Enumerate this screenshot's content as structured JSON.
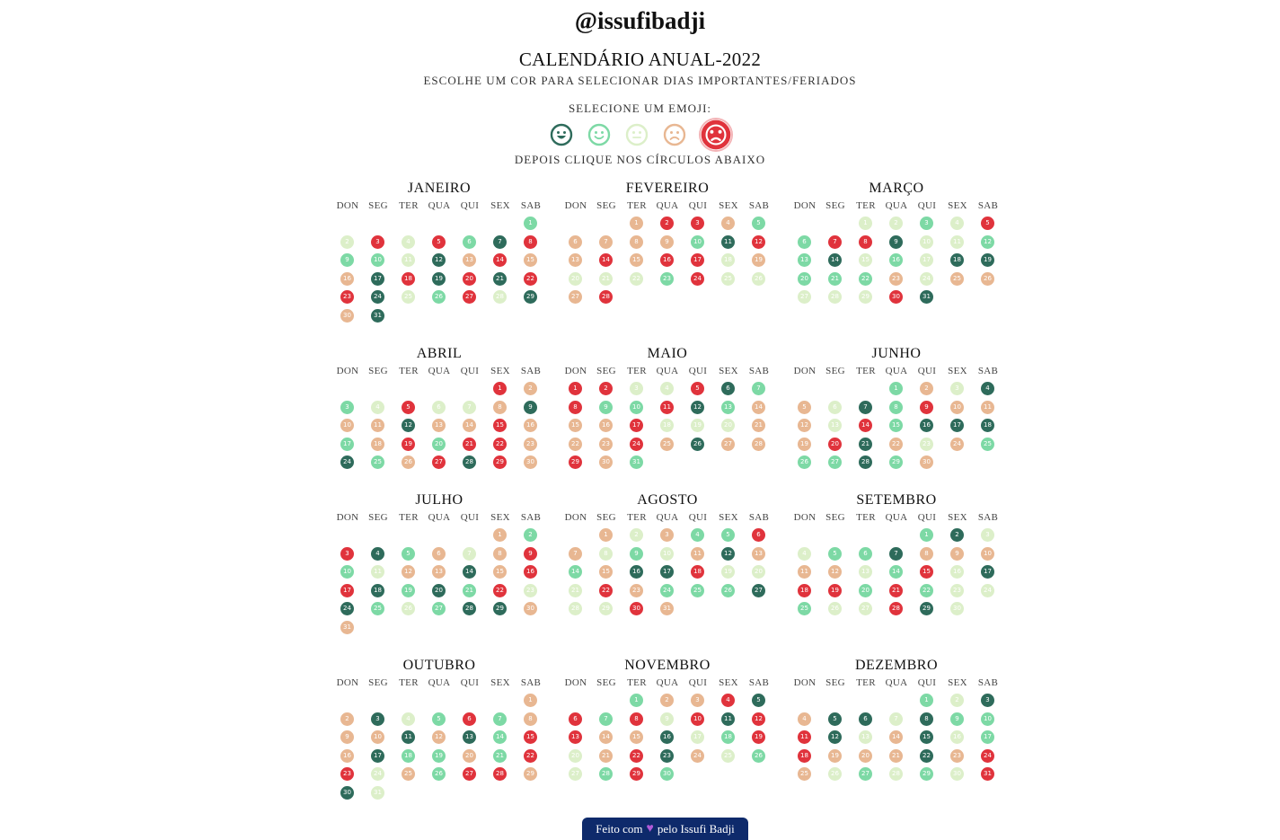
{
  "header": {
    "handle": "@issufibadji",
    "title": "CALENDÁRIO ANUAL-2022",
    "subtitle": "ESCOLHE UM COR PARA SELECIONAR DIAS IMPORTANTES/FERIADOS",
    "emoji_label": "SELECIONE UM EMOJI:",
    "after_label": "DEPOIS CLIQUE NOS CÍRCULOS ABAIXO"
  },
  "palette": {
    "1": "#2e6b5b",
    "2": "#7dd9a5",
    "3": "#dcefc9",
    "4": "#e8b792",
    "5": "#e0333c"
  },
  "emojis": [
    {
      "name": "grinning-face-icon",
      "face": "grin",
      "color": "#2e6b5b",
      "selected": false
    },
    {
      "name": "smiling-face-icon",
      "face": "smile",
      "color": "#7dd9a5",
      "selected": false
    },
    {
      "name": "neutral-face-icon",
      "face": "neutral",
      "color": "#dcefc9",
      "selected": false
    },
    {
      "name": "frowning-face-icon",
      "face": "frown",
      "color": "#e8b792",
      "selected": false
    },
    {
      "name": "angry-face-icon",
      "face": "angry",
      "color": "#e0333c",
      "selected": true
    }
  ],
  "weekday_labels": [
    "DON",
    "SEG",
    "TER",
    "QUA",
    "QUI",
    "SEX",
    "SAB"
  ],
  "months": [
    {
      "name": "JANEIRO",
      "start": 6,
      "colors": "2353521 5223145 4415151 5513253 1413233 32"
    },
    {
      "name": "FEVEREIRO",
      "start": 2,
      "colors": "45542 4444215 4545534 3332533 4 5"
    },
    {
      "name": "MARÇO",
      "start": 2,
      "colors": "3323 5255133 2213 2311222 4344333 5151 24 554 3 3 3 2"
    },
    {
      "name": "ABRIL",
      "start": 5,
      "colors": "54 2353341 4414 4542 4525 5 41 24 51 5443 4 5 5"
    },
    {
      "name": "MAIO",
      "start": 0,
      "colors": "5533512 5 22512 4 44533 34 4 4 5 4 1 4 4 5 4 2 2 4 4 3 1 4 4 3 3"
    },
    {
      "name": "JUNHO",
      "start": 3,
      "colors": "2431 4312544 43 5 2111 4 5 1 4 3 4 2 2 2 1 2 4 3"
    },
    {
      "name": "JULHO",
      "start": 5,
      "colors": "42 5124345 2344145 5 1 21 2 53 1 2 3 2 1 1 4 4 2 5 1 5"
    },
    {
      "name": "AGOSTO",
      "start": 1,
      "colors": "43422 54 32341 4 2 4 1 1 5 3 3 3 5 4 2 2 2 1 3 3 5 4 4 5"
    },
    {
      "name": "SETEMBRO",
      "start": 4,
      "colors": "21 3322144 444325 3 1 5 5 2 5 2 3 3 2 3 3 5 1 3 3 2"
    },
    {
      "name": "OUTUBRO",
      "start": 6,
      "colors": "4 4132524 441412 5 4 1 2 2 4 2 5 5 3 4 2 5 5 4 1 3 3 4 3 1 1 2 2 2 1 2"
    },
    {
      "name": "NOVEMBRO",
      "start": 2,
      "colors": "244 515253 5 1 5 5 4 4 1 3 2 5 3 4 5 1 4 3 2 3 2 5 2 1 1 1"
    },
    {
      "name": "DEZEMBRO",
      "start": 4,
      "colors": "2 3 1 4 1 1 3 1 2 2 5 1 3 4 1 3 2 5 4 4 4 1 4 5 4 3 2 3 2 3 5"
    }
  ],
  "footer": {
    "made_with": "Feito com",
    "by": "pelo Issufi Badji"
  }
}
